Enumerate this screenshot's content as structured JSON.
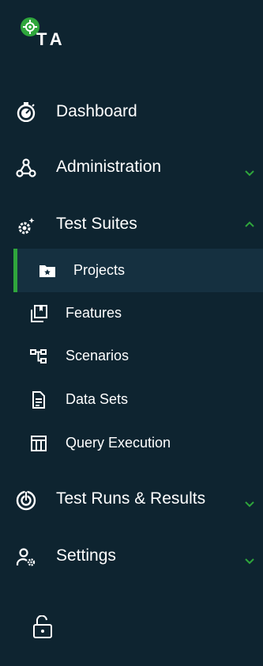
{
  "logo": {
    "text": "TA"
  },
  "nav": {
    "dashboard": {
      "label": "Dashboard",
      "icon": "stopwatch-icon"
    },
    "administration": {
      "label": "Administration",
      "icon": "webhook-icon"
    },
    "test_suites": {
      "label": "Test Suites",
      "icon": "gears-icon"
    },
    "test_runs": {
      "label": "Test Runs & Results",
      "icon": "target-icon"
    },
    "settings": {
      "label": "Settings",
      "icon": "user-gear-icon"
    }
  },
  "subnav": {
    "projects": {
      "label": "Projects",
      "icon": "folder-star-icon"
    },
    "features": {
      "label": "Features",
      "icon": "collections-icon"
    },
    "scenarios": {
      "label": "Scenarios",
      "icon": "account-tree-icon"
    },
    "data_sets": {
      "label": "Data Sets",
      "icon": "document-icon"
    },
    "query_execution": {
      "label": "Query Execution",
      "icon": "table-layout-icon"
    }
  },
  "colors": {
    "background": "#0e2430",
    "accent": "#2fa63c",
    "active_bg": "#153040",
    "text": "#ffffff"
  }
}
